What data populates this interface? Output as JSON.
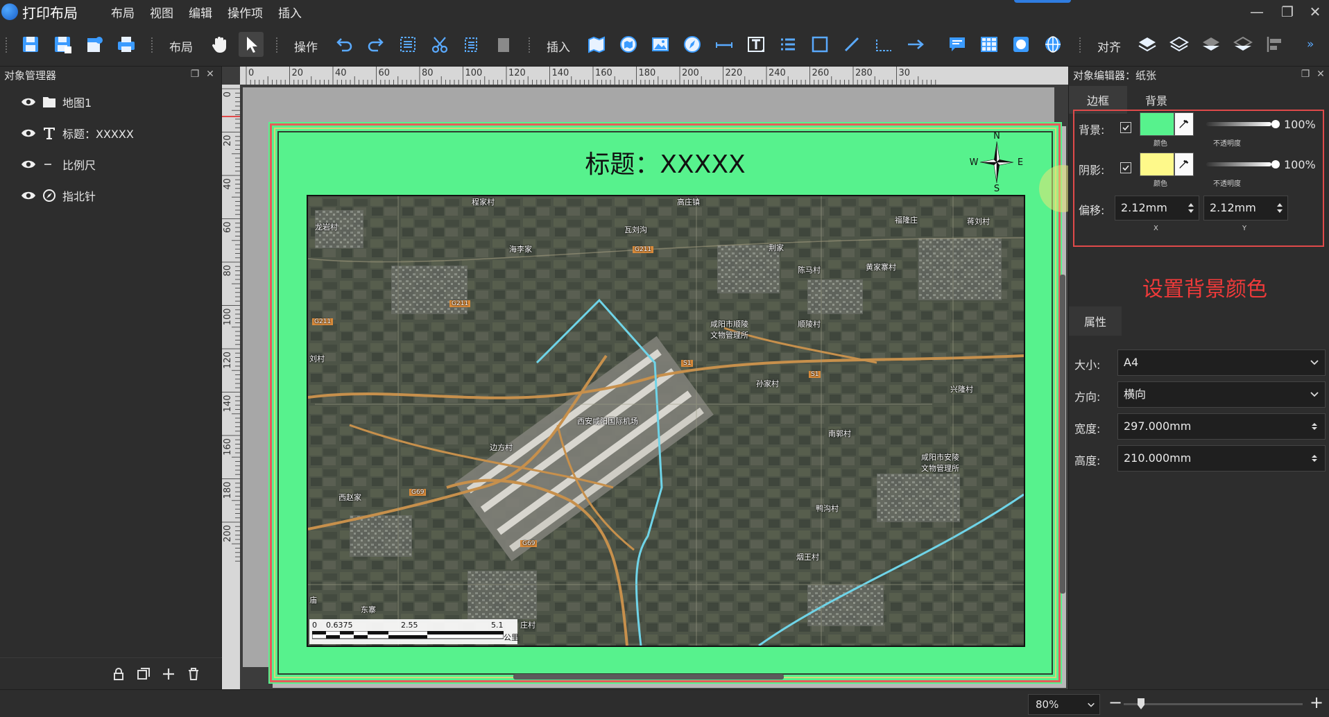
{
  "app": {
    "title": "打印布局",
    "menu": [
      "布局",
      "视图",
      "编辑",
      "操作项",
      "插入"
    ]
  },
  "toolbar": {
    "group_layout": "布局",
    "group_operate": "操作",
    "group_insert": "插入",
    "group_align": "对齐",
    "more": "»"
  },
  "object_manager": {
    "title": "对象管理器",
    "items": [
      {
        "label": "地图1",
        "icon": "folder-icon"
      },
      {
        "label": "标题：XXXXX",
        "icon": "text-t-icon"
      },
      {
        "label": "比例尺",
        "icon": "scalebar-dash-icon"
      },
      {
        "label": "指北针",
        "icon": "compass-icon"
      }
    ]
  },
  "layout": {
    "ruler_top": [
      "0",
      "20",
      "40",
      "60",
      "80",
      "100",
      "120",
      "140",
      "160",
      "180",
      "200",
      "220",
      "240",
      "260",
      "280",
      "30"
    ],
    "ruler_left": [
      "0",
      "20",
      "40",
      "60",
      "80",
      "100",
      "120",
      "140",
      "160",
      "180",
      "200"
    ],
    "map_title": "标题：XXXXX",
    "compass": {
      "n": "N",
      "s": "S",
      "w": "W",
      "e": "E"
    },
    "map_labels": {
      "l1": "程家村",
      "l2": "高庄镇",
      "l3": "龙岩村",
      "l4": "瓦刘沟",
      "l5": "福隆庄",
      "l6": "蒋刘村",
      "l7": "海李家",
      "l8": "G211",
      "l9": "荆家",
      "l10": "黄家寨村",
      "l11": "陈马村",
      "l12": "G211",
      "l13": "G211",
      "l14": "咸阳市顺陵",
      "l15": "文物管理所",
      "l16": "顺陵村",
      "l17": "刘村",
      "l18": "S1",
      "l19": "S1",
      "l20": "孙家村",
      "l21": "兴隆村",
      "l22": "西安咸阳国际机场",
      "l23": "南郭村",
      "l24": "边方村",
      "l25": "咸阳市安陵",
      "l26": "文物管理所",
      "l27": "G69",
      "l28": "西赵家",
      "l29": "G69",
      "l30": "鸭沟村",
      "l31": "烟王村",
      "l32": "东寨",
      "l33": "庄村",
      "l34": "庙"
    },
    "scalebar": {
      "ticks": [
        "0",
        "0.6375",
        "2.55",
        "5.1"
      ],
      "unit": "公里"
    }
  },
  "editor": {
    "title": "对象编辑器：纸张",
    "tabs": [
      "边框",
      "背景"
    ],
    "background": {
      "label": "背景:",
      "checked": true,
      "color": "#57f28d",
      "color_caption": "颜色",
      "opacity": "100%",
      "opacity_caption": "不透明度"
    },
    "shadow": {
      "label": "阴影:",
      "checked": true,
      "color": "#fef98a",
      "color_caption": "颜色",
      "opacity": "100%",
      "opacity_caption": "不透明度"
    },
    "offset": {
      "label": "偏移:",
      "x_value": "2.12mm",
      "y_value": "2.12mm",
      "x_caption": "X",
      "y_caption": "Y"
    },
    "hint": "设置背景颜色",
    "properties": {
      "tab": "属性",
      "size_label": "大小:",
      "size_value": "A4",
      "orientation_label": "方向:",
      "orientation_value": "横向",
      "width_label": "宽度:",
      "width_value": "297.000mm",
      "height_label": "高度:",
      "height_value": "210.000mm"
    }
  },
  "status": {
    "zoom": "80%",
    "zoom_minus": "−",
    "zoom_plus": "+"
  }
}
